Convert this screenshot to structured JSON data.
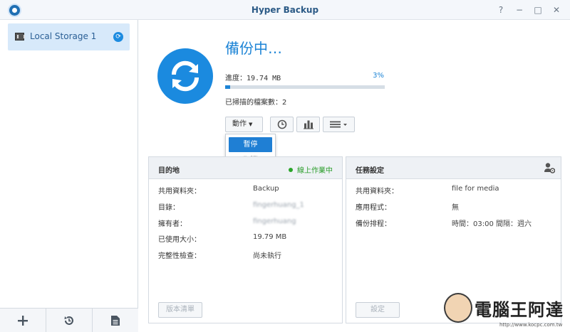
{
  "window": {
    "title": "Hyper Backup",
    "controls": [
      "?",
      "−",
      "□",
      "✕"
    ]
  },
  "sidebar": {
    "items": [
      {
        "label": "Local Storage 1",
        "icon": "storage-icon",
        "status_icon": "sync-icon"
      }
    ],
    "footer_buttons": [
      {
        "icon": "plus-icon"
      },
      {
        "icon": "restore-history-icon"
      },
      {
        "icon": "log-document-icon"
      }
    ]
  },
  "main": {
    "status_title": "備份中…",
    "progress_label": "進度：",
    "progress_value": "19.74 MB",
    "progress_percent": "3%",
    "progress_fraction": 0.03,
    "scanned_label": "已掃描的檔案數：",
    "scanned_value": "2",
    "action_button": "動作",
    "dropdown": {
      "items": [
        "暫停",
        "取消"
      ],
      "selected": "暫停"
    },
    "toolbar_icons": [
      "clock-icon",
      "bar-chart-icon",
      "list-menu-icon"
    ]
  },
  "destination_panel": {
    "title": "目的地",
    "status": "線上作業中",
    "status_color": "#2aa52a",
    "rows": [
      {
        "key": "共用資料夾：",
        "value": "Backup"
      },
      {
        "key": "目錄：",
        "value": "fingerhuang_1"
      },
      {
        "key": "擁有者：",
        "value": "fingerhuang"
      },
      {
        "key": "已使用大小：",
        "value": "19.79 MB"
      },
      {
        "key": "完整性檢查：",
        "value": "尚未執行"
      }
    ],
    "button": "版本清單"
  },
  "task_panel": {
    "title": "任務設定",
    "rows": [
      {
        "key": "共用資料夾：",
        "value": "file for media"
      },
      {
        "key": "應用程式：",
        "value": "無"
      },
      {
        "key": "備份排程：",
        "value": "時間：03:00 間隔：週六"
      }
    ],
    "button": "設定"
  },
  "watermark": {
    "text": "電腦王阿達",
    "url": "http://www.kocpc.com.tw"
  },
  "colors": {
    "accent": "#1d84d6",
    "sidebar_selected": "#d7e9fa",
    "online_green": "#2aa52a"
  }
}
